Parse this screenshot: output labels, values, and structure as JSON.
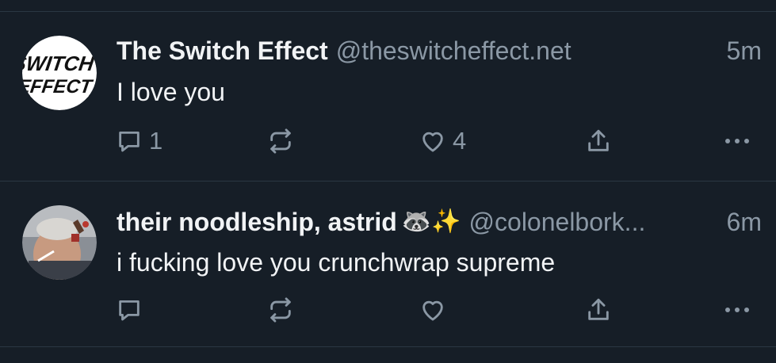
{
  "posts": [
    {
      "display_name": "The Switch Effect",
      "handle": "@theswitcheffect.net",
      "timestamp": "5m",
      "text": "I love you",
      "reply_count": "1",
      "like_count": "4",
      "avatar_text_1": "SWITCH",
      "avatar_text_2": "EFFECT"
    },
    {
      "display_name": "their noodleship, astrid",
      "emoji": "🦝✨",
      "handle": "@colonelbork...",
      "timestamp": "6m",
      "text": "i fucking love you crunchwrap supreme",
      "reply_count": "",
      "like_count": ""
    }
  ],
  "colors": {
    "background": "#161e27",
    "divider": "#2a3743",
    "primary_text": "#f1f3f5",
    "secondary_text": "#8b98a5"
  },
  "icons": [
    "reply-icon",
    "repost-icon",
    "like-icon",
    "share-icon",
    "more-icon"
  ]
}
